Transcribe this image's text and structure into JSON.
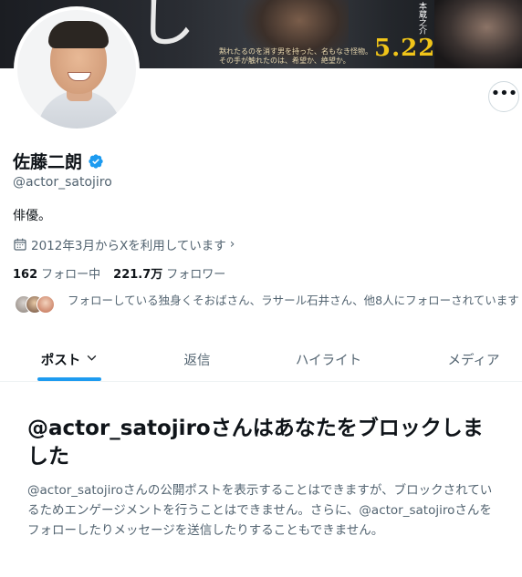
{
  "banner": {
    "glyph": "し",
    "release_date": "5.22",
    "tagline": "黙れたるのを消す男を持った、名もなき怪物。\nその手が触れたのは、希望か、絶望か。",
    "vertical_text": "本蔵之介"
  },
  "profile": {
    "display_name": "佐藤二朗",
    "handle": "@actor_satojiro",
    "bio": "俳優。",
    "joined": "2012年3月からXを利用しています",
    "following_count": "162",
    "following_label": "フォロー中",
    "followers_count": "221.7万",
    "followers_label": "フォロワー",
    "known_followers": "フォローしている独身くそおばさん、ラサール石井さん、他8人にフォローされています"
  },
  "icons": {
    "more": "more-horizontal-icon",
    "verified": "verified-badge-icon",
    "calendar": "calendar-icon",
    "chevron": "chevron-right-icon",
    "tab_caret": "chevron-down-icon"
  },
  "colors": {
    "accent": "#1d9bf0",
    "text_primary": "#0f1419",
    "text_secondary": "#536471",
    "release_date": "#f0c419"
  },
  "tabs": [
    {
      "label": "ポスト"
    },
    {
      "label": "返信"
    },
    {
      "label": "ハイライト"
    },
    {
      "label": "メディア"
    }
  ],
  "blocked_notice": {
    "title": "@actor_satojiroさんはあなたをブロックしました",
    "description": "@actor_satojiroさんの公開ポストを表示することはできますが、ブロックされているためエンゲージメントを行うことはできません。さらに、@actor_satojiroさんをフォローしたりメッセージを送信したりすることもできません。"
  }
}
